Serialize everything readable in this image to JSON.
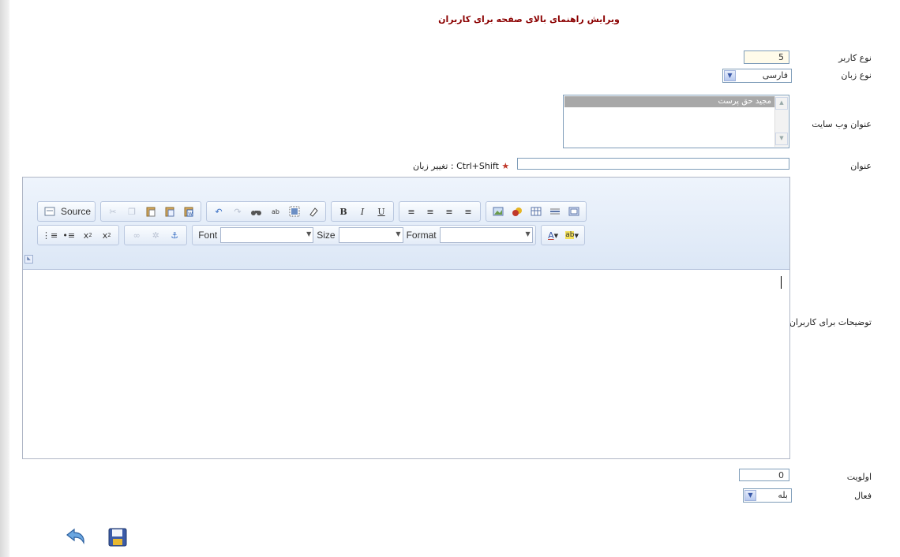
{
  "page": {
    "title": "ویرایش راهنمای بالای صفحه برای کاربران"
  },
  "form": {
    "user_type": {
      "label": "نوع کاربر",
      "value": "5"
    },
    "language": {
      "label": "نوع زبان",
      "selected": "فارسی"
    },
    "website_title": {
      "label": "عنوان وب سایت",
      "items": [
        "مجید حق پرست"
      ]
    },
    "title": {
      "label": "عنوان",
      "value": "",
      "hint_star": "★",
      "hint": "تغییر زبان : Ctrl+Shift"
    },
    "description": {
      "label": "توضیحات برای کاربران"
    },
    "priority": {
      "label": "اولویت",
      "value": "0"
    },
    "active": {
      "label": "فعال",
      "selected": "بله"
    }
  },
  "editor": {
    "source_label": "Source",
    "font_label": "Font",
    "size_label": "Size",
    "format_label": "Format",
    "font_value": "",
    "size_value": "",
    "format_value": "",
    "toolbar_icons": {
      "row1": [
        "source-icon",
        "cut-icon",
        "copy-icon",
        "paste-icon",
        "paste-text-icon",
        "paste-word-icon",
        "undo-icon",
        "redo-icon",
        "find-icon",
        "replace-icon",
        "select-all-icon",
        "remove-format-icon",
        "bold-icon",
        "italic-icon",
        "underline-icon",
        "align-left-icon",
        "align-center-icon",
        "align-right-icon",
        "justify-icon",
        "image-icon",
        "flash-icon",
        "table-icon",
        "horizontal-rule-icon",
        "iframe-icon"
      ],
      "row2": [
        "numbered-list-icon",
        "bulleted-list-icon",
        "subscript-icon",
        "superscript-icon",
        "link-icon",
        "unlink-icon",
        "anchor-icon",
        "text-color-icon",
        "background-color-icon"
      ]
    }
  },
  "actions": {
    "back_icon": "back-arrow-icon",
    "save_icon": "save-floppy-icon"
  },
  "colors": {
    "title": "#8b0000",
    "toolbar_bg": "#dce7f6",
    "input_border": "#7f9db9",
    "list_selected": "#a8a8a8"
  }
}
